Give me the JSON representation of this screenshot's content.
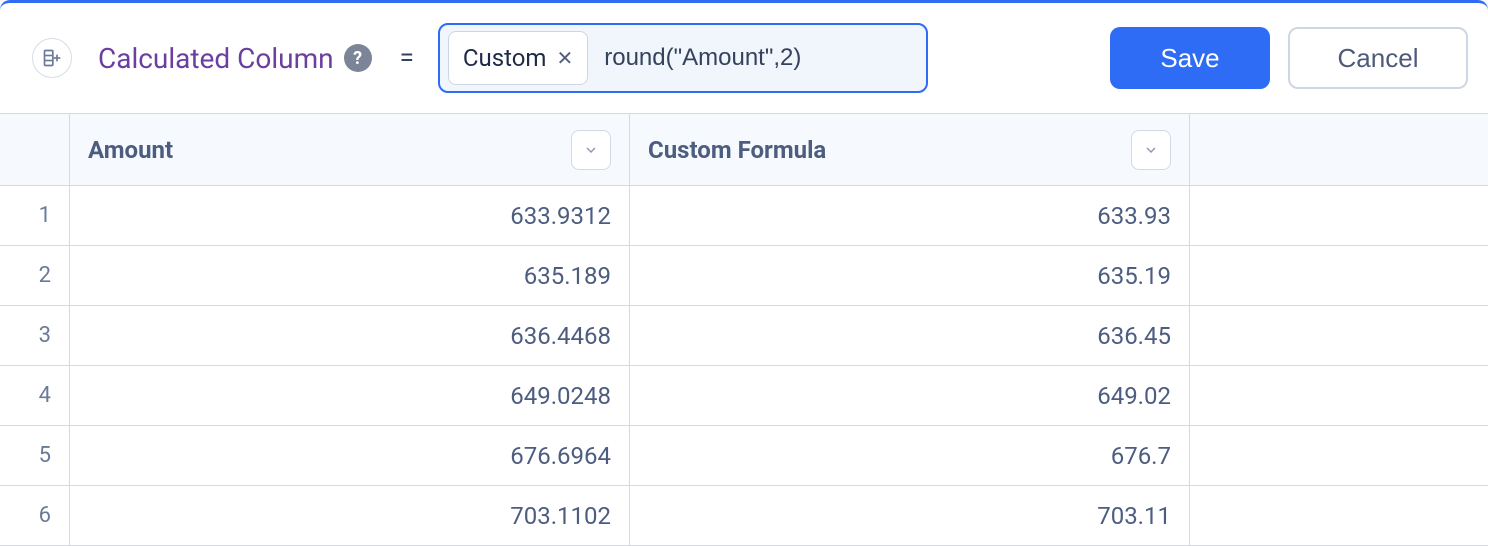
{
  "toolbar": {
    "title": "Calculated Column",
    "equals": "=",
    "chip_label": "Custom",
    "formula_value": "round(\"Amount\",2)",
    "save_label": "Save",
    "cancel_label": "Cancel"
  },
  "table": {
    "columns": [
      {
        "label": "Amount"
      },
      {
        "label": "Custom Formula"
      }
    ],
    "rows": [
      {
        "n": "1",
        "amount": "633.9312",
        "formula": "633.93"
      },
      {
        "n": "2",
        "amount": "635.189",
        "formula": "635.19"
      },
      {
        "n": "3",
        "amount": "636.4468",
        "formula": "636.45"
      },
      {
        "n": "4",
        "amount": "649.0248",
        "formula": "649.02"
      },
      {
        "n": "5",
        "amount": "676.6964",
        "formula": "676.7"
      },
      {
        "n": "6",
        "amount": "703.1102",
        "formula": "703.11"
      }
    ]
  }
}
